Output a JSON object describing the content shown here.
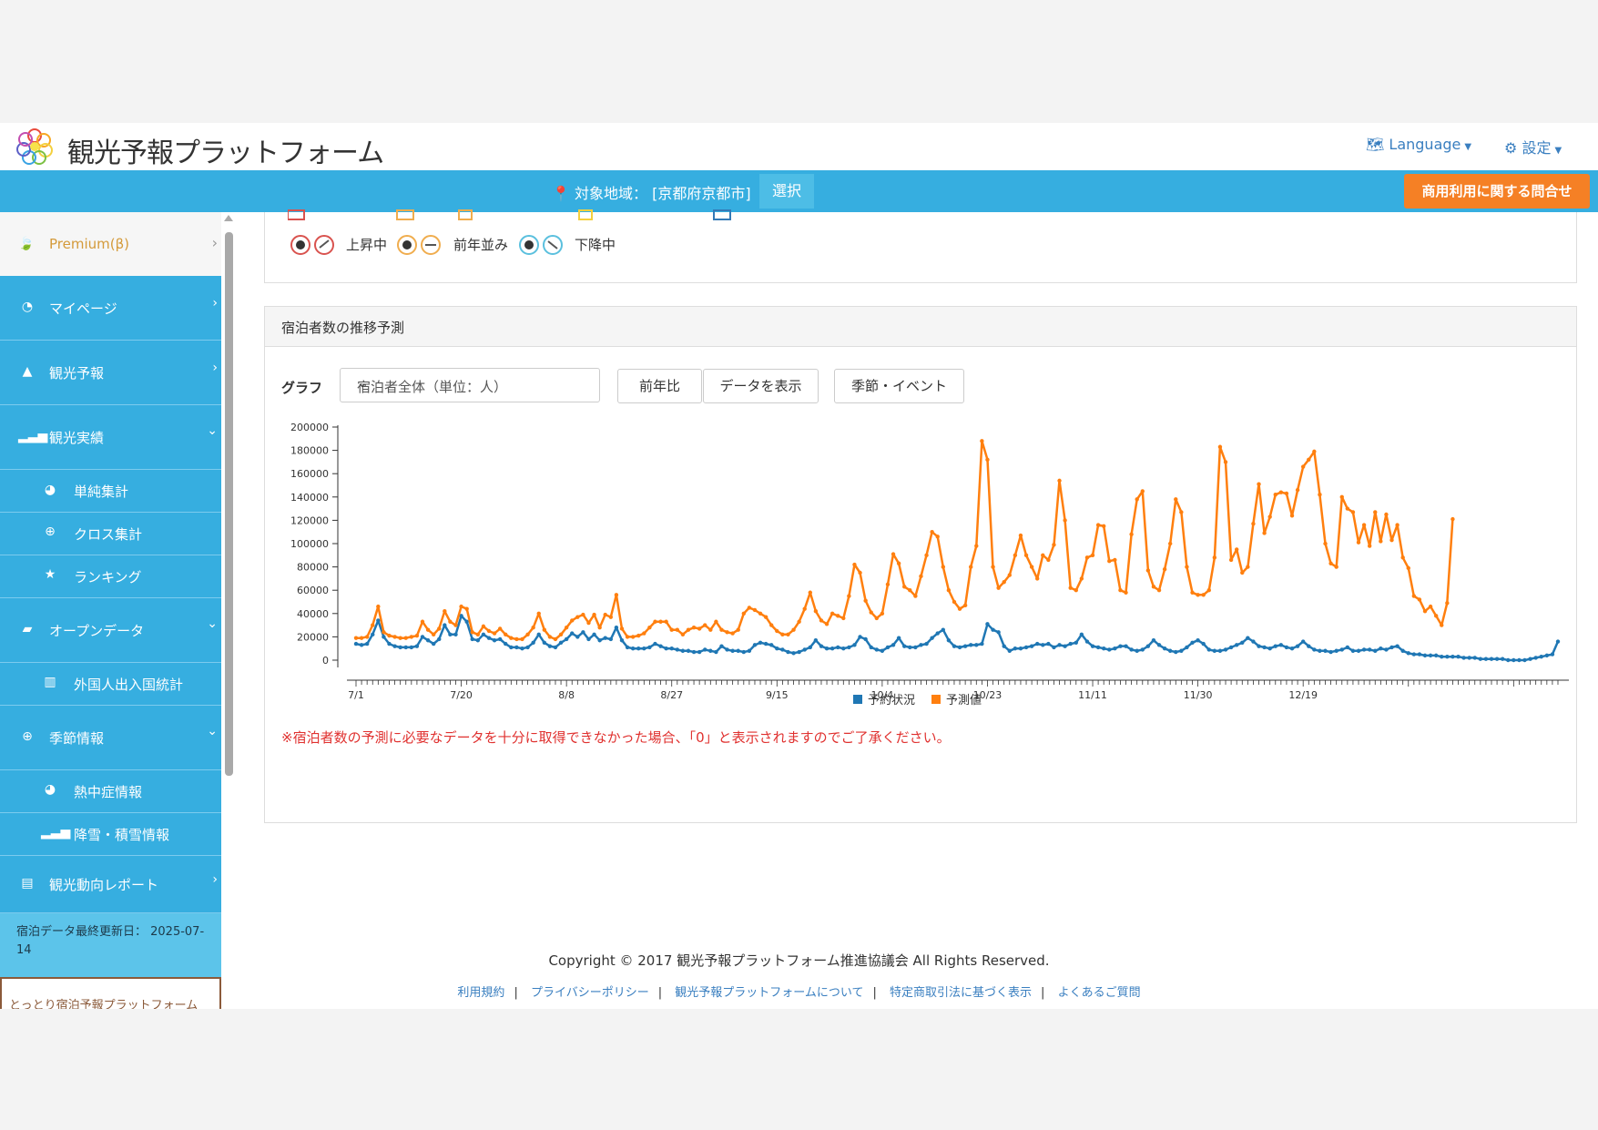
{
  "header": {
    "logo_text": "観光予報プラットフォーム",
    "language_label": "Language",
    "settings_label": "設定"
  },
  "region_bar": {
    "target_label": "対象地域：",
    "region": "[京都府京都市]",
    "select_label": "選択",
    "business_inquiry": "商用利用に関する問合せ"
  },
  "sidebar": {
    "premium": "Premium(β)",
    "items": [
      {
        "label": "マイページ",
        "icon": "dashboard-icon"
      },
      {
        "label": "観光予報",
        "icon": "area-chart-icon"
      },
      {
        "label": "観光実績",
        "icon": "signal-icon"
      },
      {
        "label": "単純集計",
        "icon": "pie-chart-icon"
      },
      {
        "label": "クロス集計",
        "icon": "search-plus-icon"
      },
      {
        "label": "ランキング",
        "icon": "star-icon"
      },
      {
        "label": "オープンデータ",
        "icon": "folder-open-icon"
      },
      {
        "label": "外国人出入国統計",
        "icon": "bar-chart-icon"
      },
      {
        "label": "季節情報",
        "icon": "search-plus-icon"
      },
      {
        "label": "熱中症情報",
        "icon": "pie-chart-icon"
      },
      {
        "label": "降雪・積雪情報",
        "icon": "signal-icon"
      },
      {
        "label": "観光動向レポート",
        "icon": "file-icon"
      }
    ],
    "last_updated": "宿泊データ最終更新日： 2025-07-14",
    "banner_text": "とっとり宿泊予報プラットフォーム"
  },
  "trend_legend": {
    "rising": "上昇中",
    "flat": "前年並み",
    "falling": "下降中"
  },
  "panel": {
    "title": "宿泊者数の推移予測",
    "graph_label": "グラフ",
    "select_value": "宿泊者全体（単位：人）",
    "btn_yoy": "前年比",
    "btn_show_data": "データを表示",
    "btn_season": "季節・イベント",
    "note": "※宿泊者数の予測に必要なデータを十分に取得できなかった場合、「0」と表示されますのでご了承ください。"
  },
  "chart_data": {
    "type": "line",
    "ylim": [
      0,
      200000
    ],
    "yticks": [
      0,
      20000,
      40000,
      60000,
      80000,
      100000,
      120000,
      140000,
      160000,
      180000,
      200000
    ],
    "xtick_labels": [
      "7/1",
      "7/20",
      "8/8",
      "8/27",
      "9/15",
      "10/4",
      "10/23",
      "11/11",
      "11/30",
      "12/19"
    ],
    "x_start": "7/1",
    "legend": "bottom",
    "series": [
      {
        "name": "予約状況",
        "color": "#1f77b4",
        "values": [
          14000,
          13000,
          14000,
          22000,
          34000,
          20000,
          14000,
          12000,
          11000,
          11000,
          11000,
          12000,
          20000,
          17000,
          14000,
          18000,
          30000,
          22000,
          22000,
          38000,
          33000,
          18000,
          17000,
          22000,
          19000,
          17000,
          18000,
          14000,
          11000,
          11000,
          10000,
          11000,
          15000,
          22000,
          15000,
          12000,
          11000,
          15000,
          18000,
          23000,
          20000,
          24000,
          18000,
          22000,
          17000,
          19000,
          18000,
          28000,
          17000,
          11000,
          10000,
          10000,
          10000,
          11000,
          14000,
          12000,
          10000,
          10000,
          9000,
          8000,
          8000,
          7000,
          7000,
          9000,
          8000,
          7000,
          12000,
          9000,
          8000,
          8000,
          7000,
          8000,
          13000,
          15000,
          14000,
          13000,
          10000,
          9000,
          7000,
          6000,
          7000,
          9000,
          11000,
          17000,
          12000,
          10000,
          10000,
          11000,
          10000,
          11000,
          13000,
          20000,
          18000,
          11000,
          9000,
          8000,
          11000,
          13000,
          19000,
          12000,
          11000,
          11000,
          13000,
          14000,
          19000,
          23000,
          26000,
          17000,
          12000,
          11000,
          12000,
          13000,
          13000,
          14000,
          31000,
          26000,
          24000,
          12000,
          8000,
          10000,
          10000,
          11000,
          12000,
          14000,
          13000,
          14000,
          11000,
          13000,
          12000,
          14000,
          15000,
          22000,
          16000,
          12000,
          11000,
          10000,
          9000,
          10000,
          12000,
          12000,
          9000,
          8000,
          9000,
          12000,
          17000,
          13000,
          10000,
          8000,
          7000,
          8000,
          11000,
          15000,
          17000,
          14000,
          9000,
          8000,
          8000,
          9000,
          11000,
          13000,
          15000,
          19000,
          16000,
          12000,
          11000,
          10000,
          12000,
          13000,
          11000,
          10000,
          12000,
          16000,
          12000,
          9000,
          8000,
          8000,
          7000,
          8000,
          9000,
          11000,
          8000,
          8000,
          9000,
          9000,
          8000,
          10000,
          9000,
          11000,
          12000,
          8000,
          6000,
          5000,
          5000,
          4000,
          4000,
          4000,
          3000,
          3000,
          3000,
          3000,
          2000,
          2000,
          2000,
          1000,
          1000,
          1000,
          1000,
          1000,
          0,
          0,
          0,
          0,
          1000,
          2000,
          3000,
          4000,
          5000,
          16000
        ]
      },
      {
        "name": "予測値",
        "color": "#ff7f0e",
        "values": [
          19000,
          19000,
          20000,
          30000,
          46000,
          24000,
          21000,
          20000,
          19000,
          19000,
          20000,
          21000,
          33000,
          26000,
          22000,
          27000,
          42000,
          33000,
          30000,
          46000,
          44000,
          24000,
          22000,
          29000,
          25000,
          23000,
          27000,
          22000,
          19000,
          18000,
          18000,
          22000,
          28000,
          40000,
          26000,
          20000,
          18000,
          22000,
          28000,
          34000,
          37000,
          39000,
          32000,
          39000,
          28000,
          39000,
          37000,
          56000,
          27000,
          20000,
          20000,
          21000,
          23000,
          28000,
          33000,
          33000,
          33000,
          26000,
          26000,
          22000,
          26000,
          28000,
          27000,
          30000,
          26000,
          33000,
          26000,
          24000,
          23000,
          26000,
          40000,
          45000,
          43000,
          40000,
          37000,
          30000,
          25000,
          22000,
          22000,
          26000,
          33000,
          44000,
          58000,
          42000,
          34000,
          31000,
          40000,
          38000,
          36000,
          55000,
          82000,
          75000,
          51000,
          41000,
          36000,
          40000,
          65000,
          91000,
          83000,
          63000,
          60000,
          55000,
          72000,
          90000,
          110000,
          106000,
          80000,
          60000,
          50000,
          44000,
          47000,
          80000,
          98000,
          188000,
          172000,
          80000,
          62000,
          67000,
          73000,
          90000,
          107000,
          90000,
          80000,
          70000,
          90000,
          86000,
          99000,
          154000,
          120000,
          62000,
          60000,
          70000,
          88000,
          90000,
          116000,
          115000,
          85000,
          86000,
          60000,
          58000,
          108000,
          138000,
          145000,
          77000,
          63000,
          60000,
          78000,
          100000,
          138000,
          127000,
          80000,
          58000,
          56000,
          56000,
          60000,
          88000,
          183000,
          170000,
          86000,
          95000,
          75000,
          80000,
          117000,
          151000,
          109000,
          123000,
          142000,
          144000,
          143000,
          124000,
          146000,
          166000,
          172000,
          179000,
          142000,
          100000,
          83000,
          80000,
          140000,
          130000,
          127000,
          101000,
          116000,
          98000,
          127000,
          102000,
          125000,
          103000,
          116000,
          88000,
          79000,
          55000,
          52000,
          42000,
          46000,
          38000,
          30000,
          49000,
          121000
        ]
      }
    ]
  },
  "footer": {
    "copyright": "Copyright © 2017 観光予報プラットフォーム推進協議会 All Rights Reserved.",
    "links": [
      "利用規約",
      "プライバシーポリシー",
      "観光予報プラットフォームについて",
      "特定商取引法に基づく表示",
      "よくあるご質問"
    ]
  }
}
